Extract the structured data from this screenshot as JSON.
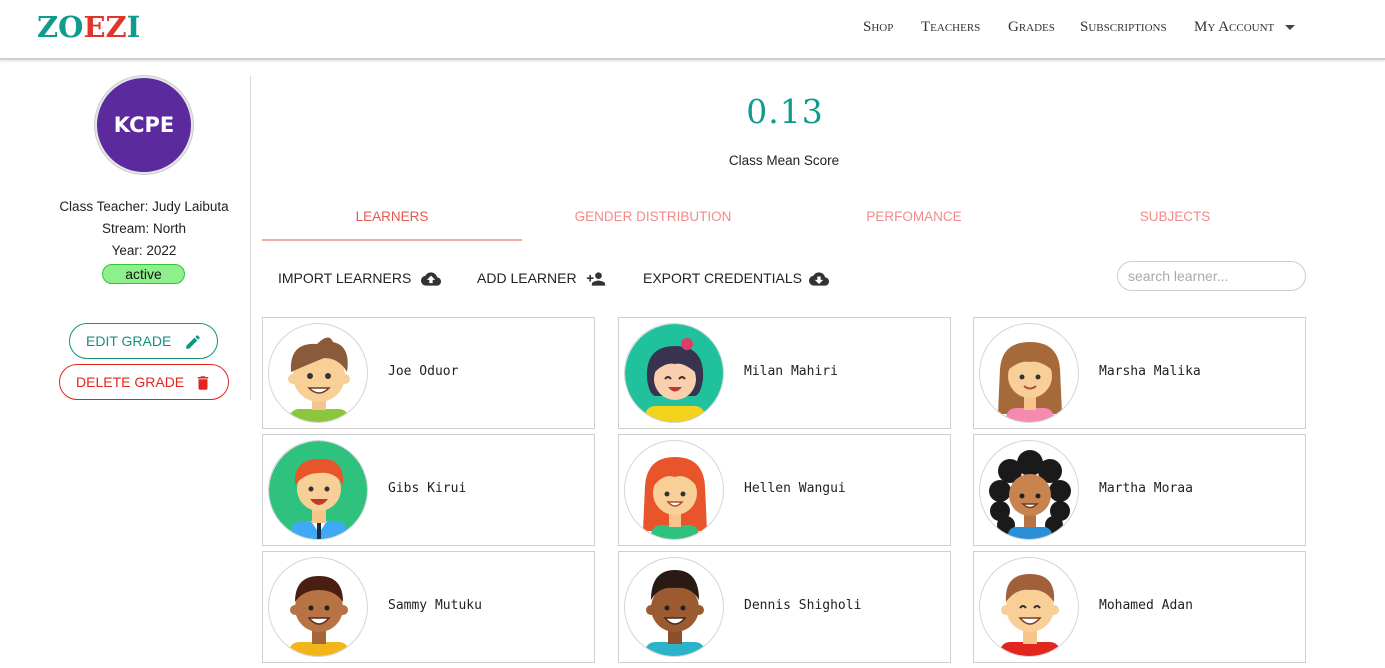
{
  "header": {
    "logo": {
      "part1": "ZO",
      "part2": "EZ",
      "part3": "I"
    },
    "nav": [
      "Shop",
      "Teachers",
      "Grades",
      "Subscriptions",
      "My Account"
    ]
  },
  "grade": {
    "badge": "KCPE",
    "teacher": "Class Teacher: Judy Laibuta",
    "stream": "Stream: North",
    "year": "Year: 2022",
    "status": "active",
    "edit_label": "EDIT GRADE",
    "delete_label": "DELETE GRADE"
  },
  "stats": {
    "mean_score": "0.13",
    "mean_label": "Class Mean Score"
  },
  "tabs": [
    "LEARNERS",
    "GENDER DISTRIBUTION",
    "PERFOMANCE",
    "SUBJECTS"
  ],
  "actions": {
    "import": "IMPORT LEARNERS",
    "add": "ADD LEARNER",
    "export": "EXPORT CREDENTIALS",
    "search_placeholder": "search learner..."
  },
  "learners": [
    {
      "name": "Joe Oduor",
      "avatar": "boy-brown-hair-icon"
    },
    {
      "name": "Milan Mahiri",
      "avatar": "girl-dark-hair-teal-bg-icon"
    },
    {
      "name": "Marsha Malika",
      "avatar": "girl-brown-hair-icon"
    },
    {
      "name": "Gibs Kirui",
      "avatar": "boy-red-hair-green-bg-icon"
    },
    {
      "name": "Hellen Wangui",
      "avatar": "girl-orange-hair-icon"
    },
    {
      "name": "Martha Moraa",
      "avatar": "girl-curly-hair-icon"
    },
    {
      "name": "Sammy Mutuku",
      "avatar": "boy-dark-skin-icon"
    },
    {
      "name": "Dennis Shigholi",
      "avatar": "boy-dark-hair-icon"
    },
    {
      "name": "Mohamed Adan",
      "avatar": "boy-light-brown-hair-icon"
    }
  ],
  "colors": {
    "brand_teal": "#0f9c8c",
    "brand_red": "#e0342c",
    "badge_purple": "#5b2a9c",
    "tab_pink": "#f28b8b"
  }
}
